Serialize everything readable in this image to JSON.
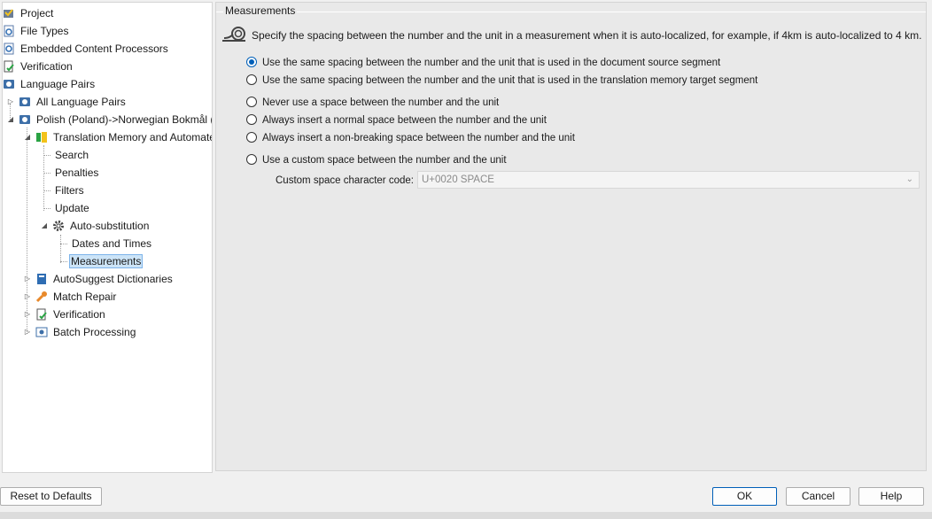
{
  "tree": {
    "items": [
      {
        "label": "Project",
        "icon": "project-icon"
      },
      {
        "label": "File Types",
        "icon": "file-types-icon"
      },
      {
        "label": "Embedded Content Processors",
        "icon": "gear-doc-icon"
      },
      {
        "label": "Verification",
        "icon": "verification-icon"
      },
      {
        "label": "Language Pairs",
        "icon": "language-pairs-icon"
      },
      {
        "label": "All Language Pairs",
        "icon": "language-pairs-icon"
      },
      {
        "label": "Polish (Poland)->Norwegian Bokmål (",
        "icon": "language-pairs-icon"
      },
      {
        "label": "Translation Memory and Automate",
        "icon": "tm-icon"
      },
      {
        "label": "Search"
      },
      {
        "label": "Penalties"
      },
      {
        "label": "Filters"
      },
      {
        "label": "Update"
      },
      {
        "label": "Auto-substitution",
        "icon": "gear-icon"
      },
      {
        "label": "Dates and Times"
      },
      {
        "label": "Measurements"
      },
      {
        "label": "AutoSuggest Dictionaries",
        "icon": "book-icon"
      },
      {
        "label": "Match Repair",
        "icon": "wrench-icon"
      },
      {
        "label": "Verification",
        "icon": "verification-icon"
      },
      {
        "label": "Batch Processing",
        "icon": "batch-icon"
      }
    ]
  },
  "panel": {
    "title": "Measurements",
    "description": "Specify the spacing between the number and the unit in a measurement when it is auto-localized, for example, if 4km is auto-localized to 4 km.",
    "options": [
      {
        "label": "Use the same spacing between the number and the unit that is used in the document source segment",
        "checked": true
      },
      {
        "label": "Use the same spacing between the number and the unit that is used in the translation memory target segment",
        "checked": false
      },
      {
        "label": "Never use a space between the number and the unit",
        "checked": false
      },
      {
        "label": "Always insert a normal space between the number and the unit",
        "checked": false
      },
      {
        "label": "Always insert a non-breaking space between the number and the unit",
        "checked": false
      },
      {
        "label": "Use a custom space between the number and the unit",
        "checked": false
      }
    ],
    "custom_label": "Custom space character code:",
    "custom_value": "U+0020 SPACE"
  },
  "buttons": {
    "reset": "Reset to Defaults",
    "ok": "OK",
    "cancel": "Cancel",
    "help": "Help"
  },
  "colors": {
    "accent": "#005fb8",
    "selection": "#cce4f7"
  }
}
